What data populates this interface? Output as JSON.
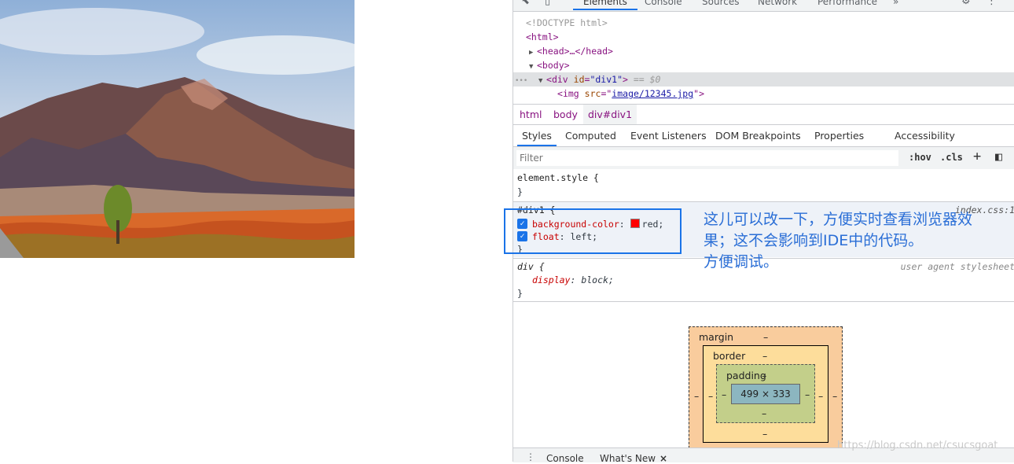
{
  "devtools": {
    "main_tabs": [
      "Elements",
      "Console",
      "Sources",
      "Network",
      "Performance"
    ],
    "more_tabs": "»",
    "dom_lines": {
      "doctype": "<!DOCTYPE html>",
      "html_open": "<html>",
      "head": "<head>…</head>",
      "body_open": "<body>",
      "div_tag": "div",
      "div_attr_name": "id",
      "div_attr_value": "\"div1\"",
      "div_suffix": " == $0",
      "img_tag": "img",
      "img_attr_name": "src",
      "img_attr_value": "image/12345.jpg",
      "ellipsis": "•••"
    },
    "breadcrumbs": [
      "html",
      "body",
      "div#div1"
    ],
    "sub_tabs": [
      "Styles",
      "Computed",
      "Event Listeners",
      "DOM Breakpoints",
      "Properties",
      "Accessibility"
    ],
    "filter_placeholder": "Filter",
    "filter_tools": {
      "hov": ":hov",
      "cls": ".cls",
      "add": "+",
      "toggle": "◧"
    },
    "styles": {
      "element_style_open": "element.style {",
      "close_brace": "}",
      "rule1_selector": "#div1 {",
      "rule1_source": "index.css:1",
      "rule1_props": [
        {
          "name": "background-color",
          "value": "red;"
        },
        {
          "name": "float",
          "value": "left;"
        }
      ],
      "rule2_selector": "div {",
      "rule2_source": "user agent stylesheet",
      "rule2_props": [
        {
          "name": "display",
          "value": "block;"
        }
      ]
    },
    "box_model": {
      "margin_label": "margin",
      "border_label": "border",
      "padding_label": "padding",
      "dash": "–",
      "content_size": "499 × 333"
    },
    "drawer_tabs": [
      "Console",
      "What's New"
    ],
    "drawer_close": "×"
  },
  "annotation": {
    "text_line1": "这儿可以改一下，方便实时查看浏览器效",
    "text_line2": "果；这不会影响到IDE中的代码。",
    "text_line3": "方便调试。"
  },
  "watermark": "https://blog.csdn.net/csucsgoat",
  "colors": {
    "accent": "#1a73e8",
    "annotation": "#2a6ed6",
    "swatch": "#ff0000"
  }
}
